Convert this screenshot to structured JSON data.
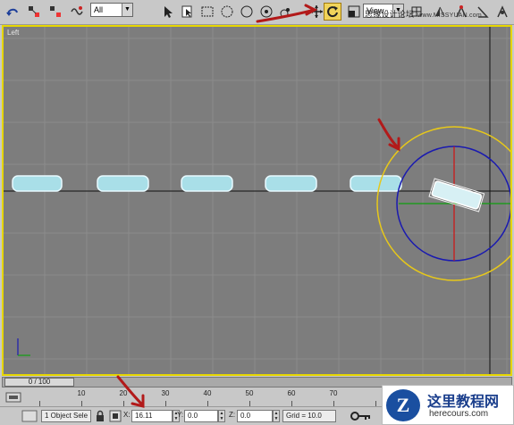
{
  "toolbar": {
    "selection_filter": "All",
    "reference_coord": "View",
    "watermark_text": "思缘设计论坛",
    "watermark_site": "www.MISSYUAN.com",
    "icons": [
      "undo-icon",
      "select-link-icon",
      "unlink-icon",
      "bind-space-warp-icon",
      "select-object-icon",
      "select-by-name-icon",
      "rect-region-icon",
      "circle-region-icon",
      "fence-region-icon",
      "lasso-region-icon",
      "paint-region-icon",
      "window-crossing-icon",
      "move-icon",
      "rotate-icon",
      "scale-icon",
      "pivot-icon",
      "mirror-icon",
      "snap-icon"
    ],
    "active_tool": "rotate"
  },
  "viewport": {
    "label": "Left",
    "accent_color": "#e6d600",
    "grid_color": "#8c8c8c",
    "background": "#7d7d7d"
  },
  "timeline": {
    "frame_display": "0 / 100",
    "ticks": [
      "10",
      "20",
      "30",
      "40",
      "50",
      "60",
      "70"
    ]
  },
  "status": {
    "selection_text": "1 Object Sele",
    "x_label": "X:",
    "x_value": "16.11",
    "y_label": "Y:",
    "y_value": "0.0",
    "z_label": "Z:",
    "z_value": "0.0",
    "grid_text": "Grid = 10.0"
  },
  "branding": {
    "logo_letter": "Z",
    "site_title": "这里教程网",
    "site_url": "herecours.com"
  }
}
